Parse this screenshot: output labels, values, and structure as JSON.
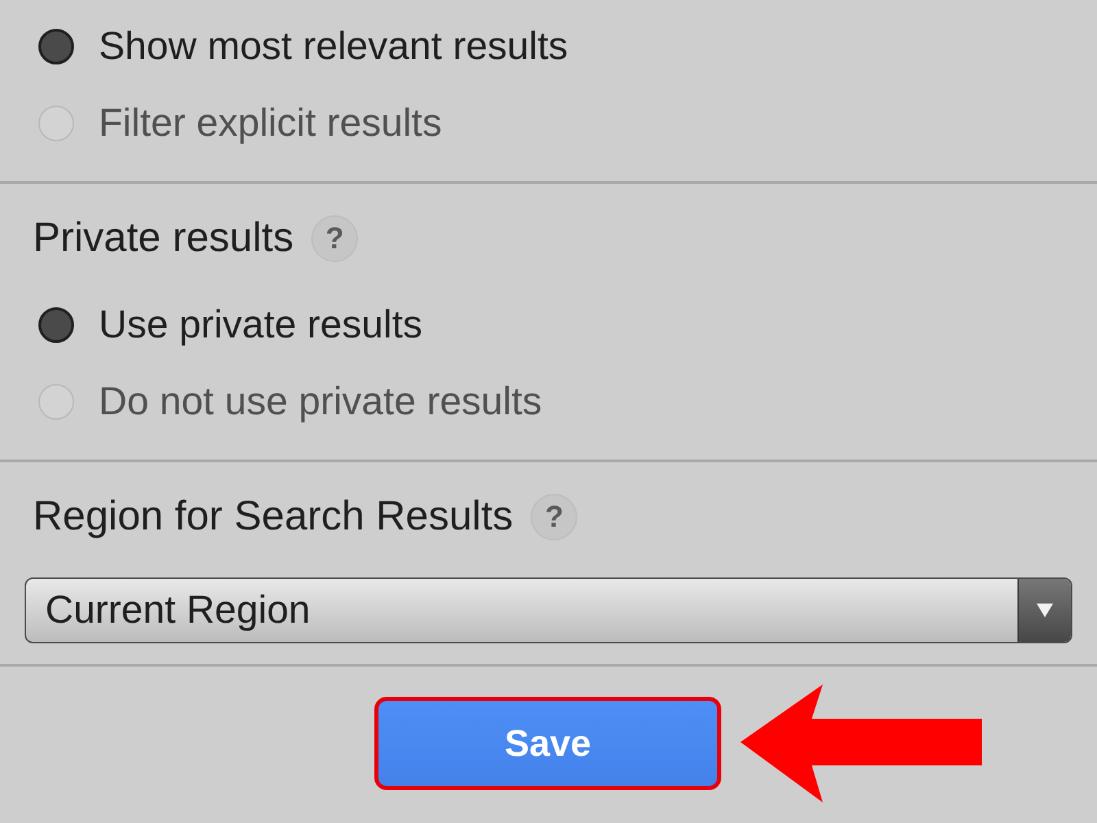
{
  "sections": [
    {
      "options": [
        {
          "label": "Show most relevant results",
          "selected": true
        },
        {
          "label": "Filter explicit results",
          "selected": false
        }
      ]
    },
    {
      "title": "Private results",
      "help": "?",
      "options": [
        {
          "label": "Use private results",
          "selected": true
        },
        {
          "label": "Do not use private results",
          "selected": false
        }
      ]
    },
    {
      "title": "Region for Search Results",
      "help": "?",
      "dropdown": {
        "value": "Current Region"
      }
    }
  ],
  "save_button": {
    "label": "Save",
    "highlighted": true
  }
}
